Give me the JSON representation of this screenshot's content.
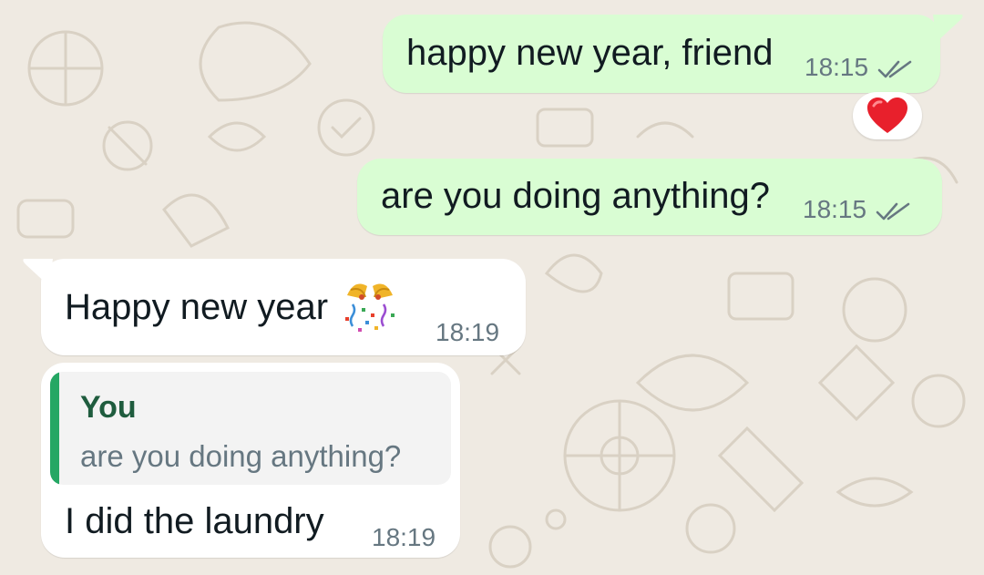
{
  "chat": {
    "messages": [
      {
        "direction": "outgoing",
        "text": "happy new year, friend",
        "time": "18:15",
        "status": "read",
        "reaction": "heart"
      },
      {
        "direction": "outgoing",
        "text": "are you doing anything?",
        "time": "18:15",
        "status": "read"
      },
      {
        "direction": "incoming",
        "text": "Happy new year",
        "emoji": "confetti-bells",
        "time": "18:19"
      },
      {
        "direction": "incoming",
        "quote": {
          "author": "You",
          "text": "are you doing anything?"
        },
        "text": "I did the laundry",
        "time": "18:19"
      }
    ]
  },
  "colors": {
    "background": "#efeae2",
    "outgoing_bubble": "#d9fdd3",
    "incoming_bubble": "#ffffff",
    "read_tick": "#667781",
    "quote_bar": "#25a764",
    "quote_author": "#1f5c3e",
    "reaction_heart": "#e8202c"
  }
}
